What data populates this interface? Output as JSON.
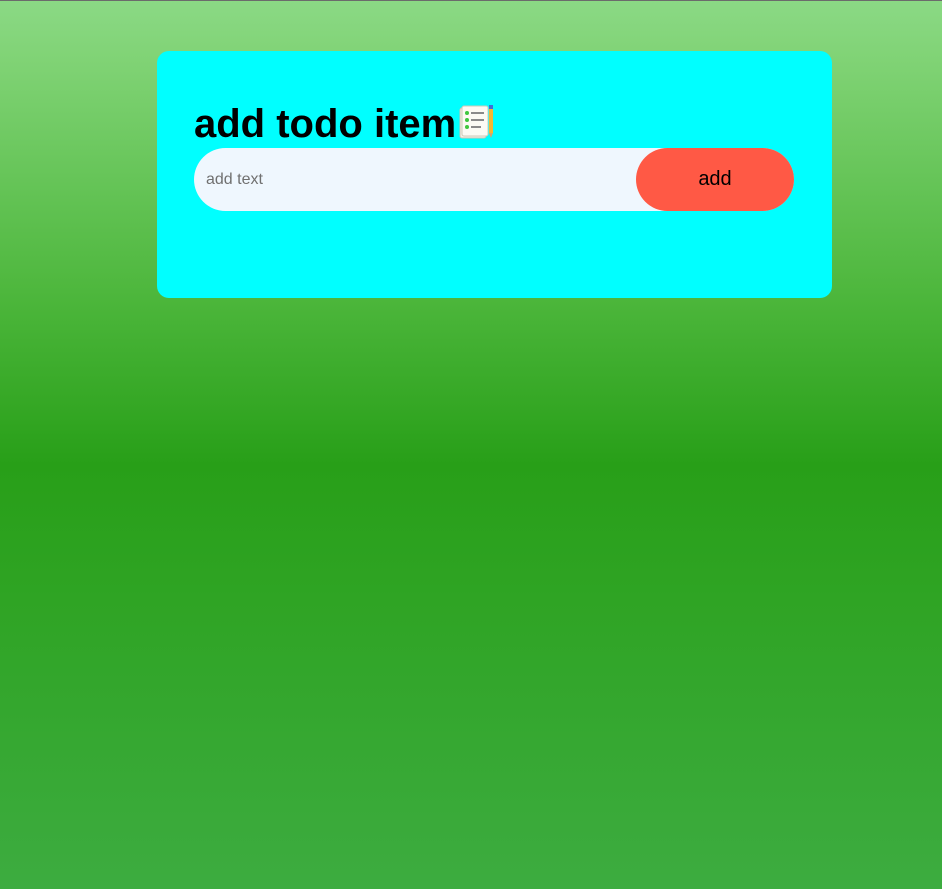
{
  "card": {
    "title": "add todo item",
    "title_icon": "checklist-with-pencil-icon",
    "background": "#00ffff"
  },
  "form": {
    "input_placeholder": "add text",
    "input_value": "",
    "add_button_label": "add",
    "add_button_color": "#ff5945"
  }
}
